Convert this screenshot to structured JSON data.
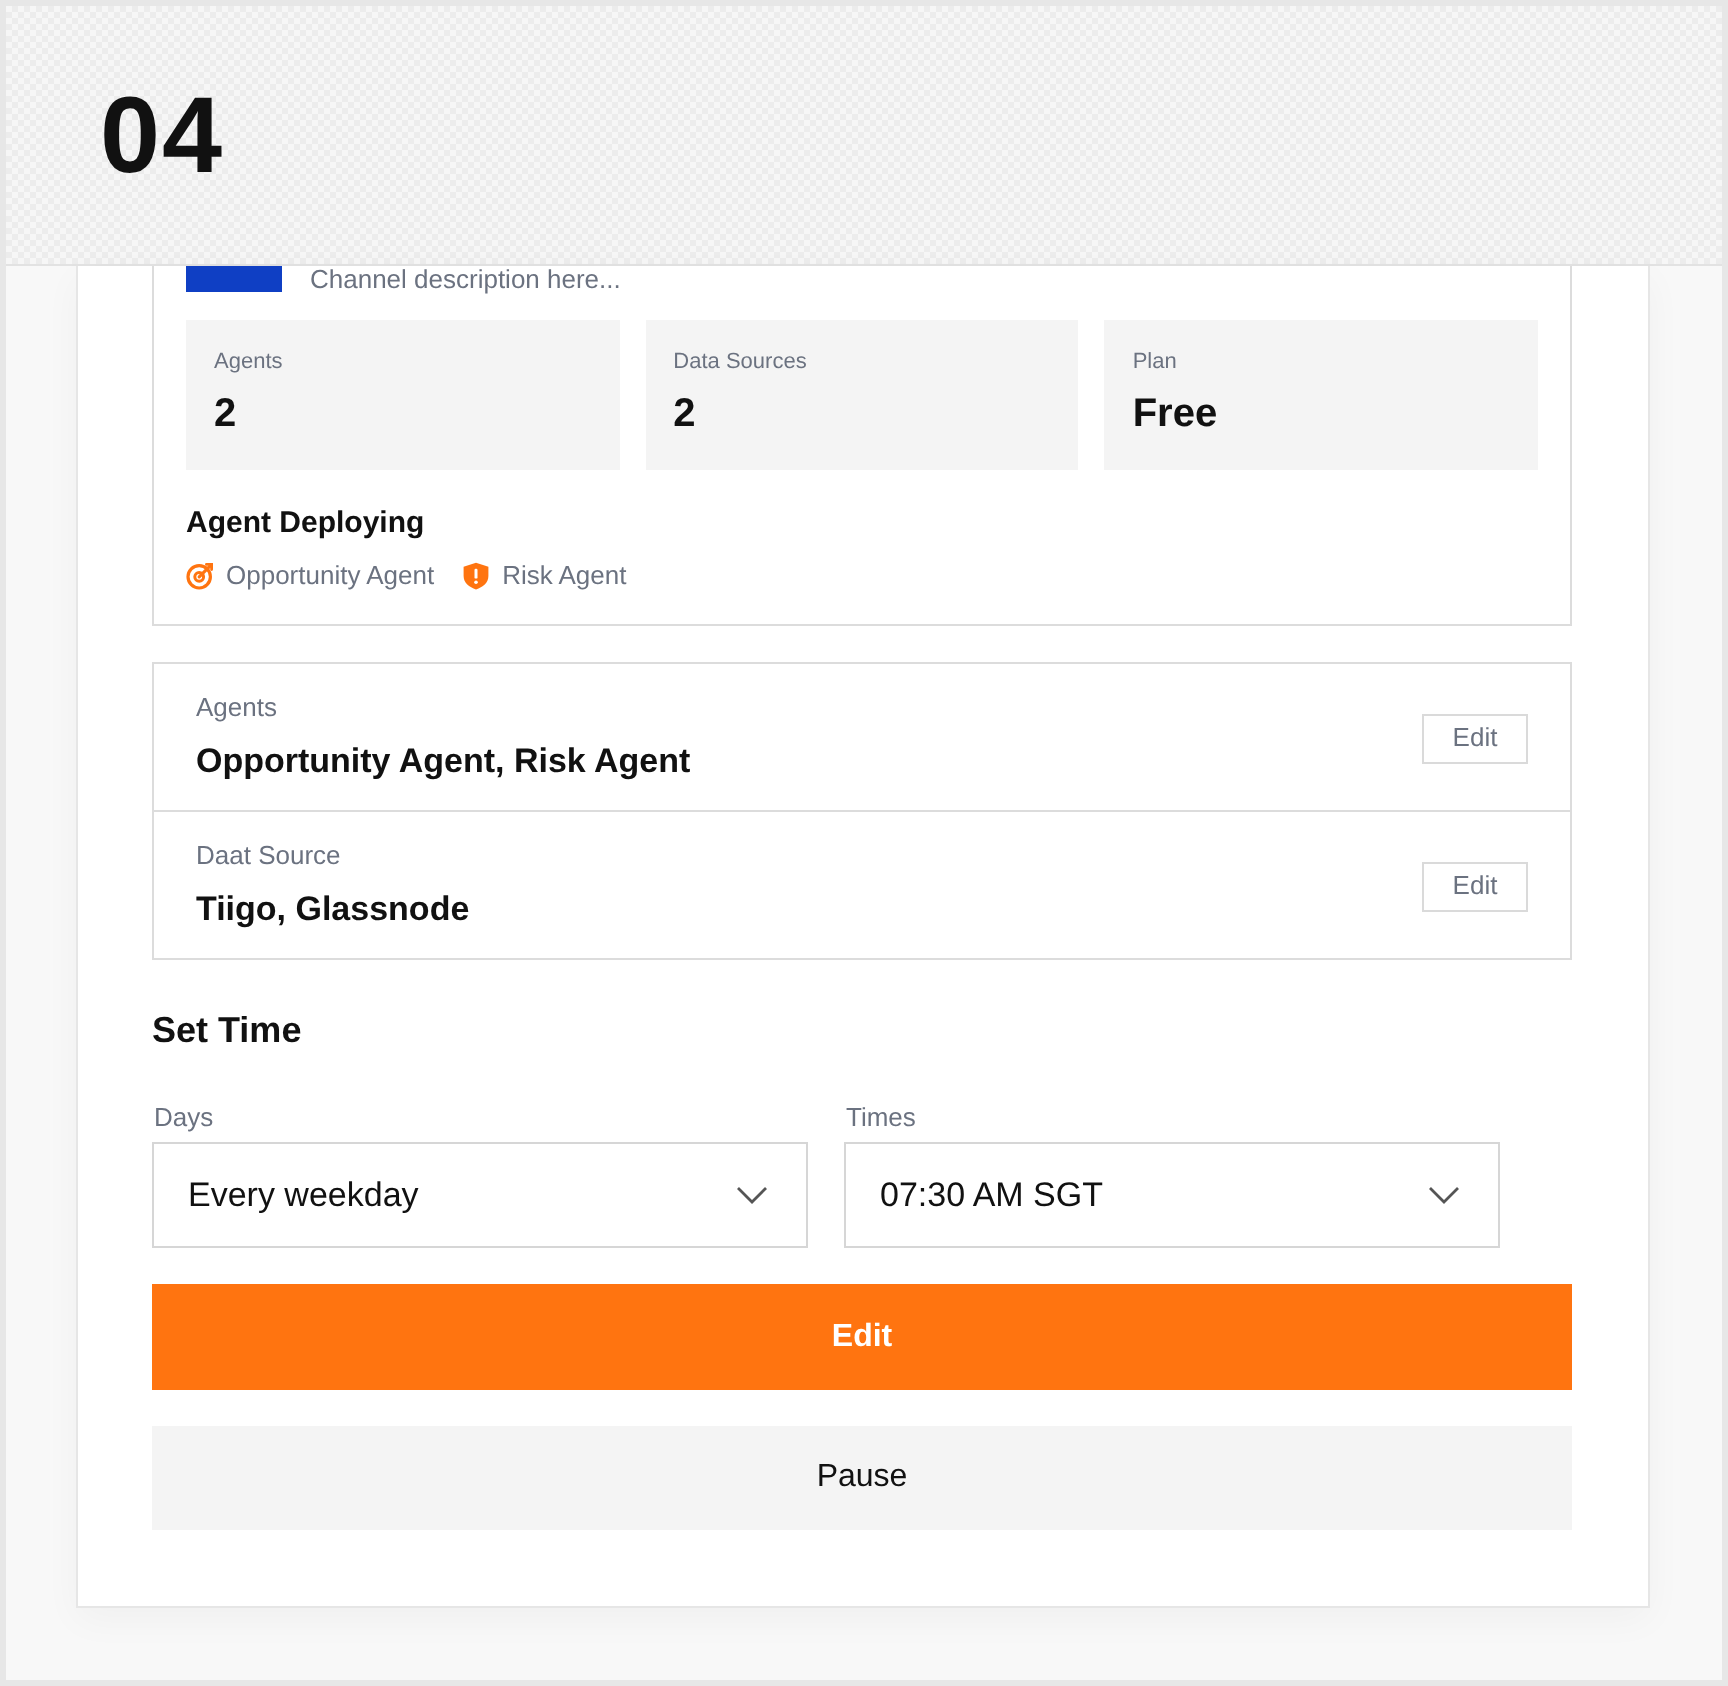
{
  "step": {
    "number": "04"
  },
  "channel": {
    "description": "Channel description here...",
    "stats": [
      {
        "label": "Agents",
        "value": "2"
      },
      {
        "label": "Data Sources",
        "value": "2"
      },
      {
        "label": "Plan",
        "value": "Free"
      }
    ],
    "deploying": {
      "title": "Agent Deploying",
      "agents": [
        {
          "name": "Opportunity Agent",
          "kind": "target"
        },
        {
          "name": "Risk Agent",
          "kind": "shield"
        }
      ]
    }
  },
  "settings": [
    {
      "label": "Agents",
      "value": "Opportunity Agent, Risk Agent",
      "button": "Edit"
    },
    {
      "label": "Daat Source",
      "value": "Tiigo, Glassnode",
      "button": "Edit"
    }
  ],
  "schedule": {
    "title": "Set Time",
    "fields": [
      {
        "label": "Days",
        "value": "Every weekday"
      },
      {
        "label": "Times",
        "value": "07:30 AM SGT"
      }
    ]
  },
  "actions": [
    {
      "label": "Edit",
      "kind": "primary"
    },
    {
      "label": "Pause",
      "kind": "secondary"
    }
  ]
}
